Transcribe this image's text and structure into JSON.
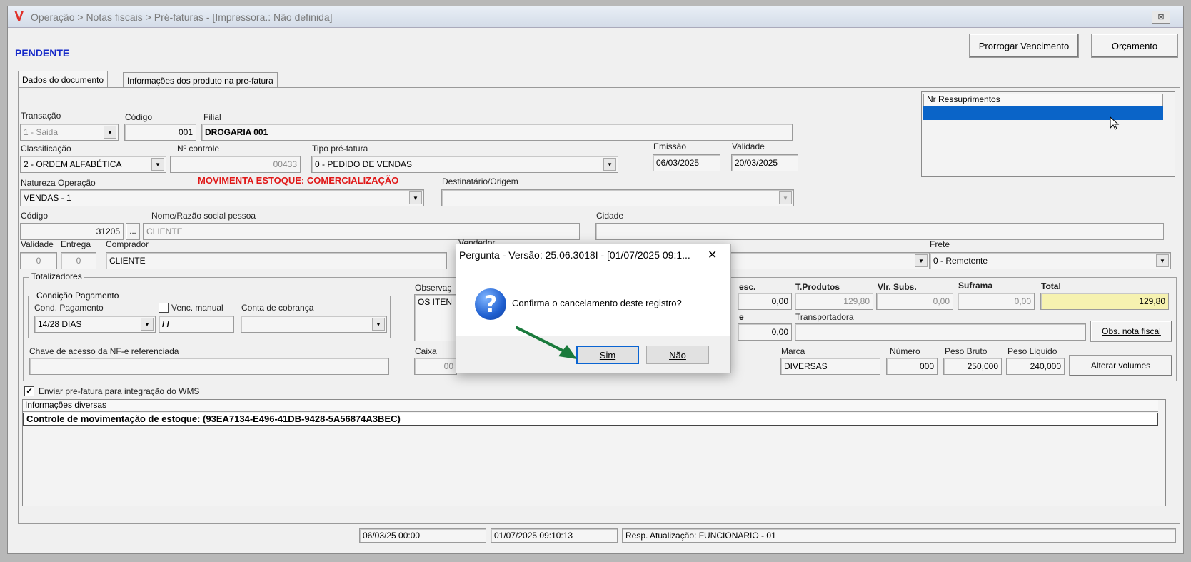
{
  "window": {
    "title": "Operação > Notas fiscais > Pré-faturas - [Impressora.: Não definida]",
    "close_glyph": "⊠",
    "logo_glyph": "V"
  },
  "status": "PENDENTE",
  "toolbar": {
    "prorrogar": "Prorrogar Vencimento",
    "orcamento": "Orçamento"
  },
  "tabs": [
    {
      "label": "Dados do documento"
    },
    {
      "label": "Informações dos produto na pre-fatura"
    }
  ],
  "form": {
    "transacao": {
      "label": "Transação",
      "value": "1 - Saida"
    },
    "codigo": {
      "label": "Código",
      "value": "001"
    },
    "filial": {
      "label": "Filial",
      "value": "DROGARIA 001"
    },
    "classificacao": {
      "label": "Classificação",
      "value": "2 - ORDEM ALFABÉTICA"
    },
    "nr_controle": {
      "label": "Nº controle",
      "value": "00433"
    },
    "tipo_prefatura": {
      "label": "Tipo pré-fatura",
      "value": "0  - PEDIDO DE VENDAS"
    },
    "emissao": {
      "label": "Emissão",
      "value": "06/03/2025"
    },
    "validade": {
      "label": "Validade",
      "value": "20/03/2025"
    },
    "natureza": {
      "label": "Natureza  Operação",
      "value": "VENDAS - 1"
    },
    "movimenta": "MOVIMENTA ESTOQUE: COMERCIALIZAÇÃO",
    "destinatario": {
      "label": "Destinatário/Origem",
      "value": ""
    },
    "cod_pessoa": {
      "label": "Código",
      "value": "31205"
    },
    "nome": {
      "label": "Nome/Razão social pessoa",
      "value": "CLIENTE"
    },
    "cidade": {
      "label": "Cidade",
      "value": ""
    },
    "validade2": {
      "label": "Validade",
      "value": "0"
    },
    "entrega": {
      "label": "Entrega",
      "value": "0"
    },
    "comprador": {
      "label": "Comprador",
      "value": "CLIENTE"
    },
    "vendedor": {
      "label": "Vendedor"
    },
    "frete": {
      "label": "Frete",
      "value": "0 - Remetente"
    },
    "ellipsis": "..."
  },
  "ressup": {
    "header": "Nr Ressuprimentos"
  },
  "totalizadores": {
    "label": "Totalizadores",
    "cond_group": "Condição Pagamento",
    "cond_label": "Cond. Pagamento",
    "cond_value": "14/28 DIAS",
    "venc_manual": "Venc. manual",
    "venc_value": "/ /",
    "conta": "Conta de cobrança",
    "observacao": "Observaç",
    "obs_value": "OS ITEN",
    "desc_label": "esc.",
    "desc_value": "0,00",
    "tprod_label": "T.Produtos",
    "tprod_value": "129,80",
    "vlsubs_label": "Vlr. Subs.",
    "vlsubs_value": "0,00",
    "suframa_label": "Suframa",
    "suframa_value": "0,00",
    "total_label": "Total",
    "total_value": "129,80",
    "e_label": "e",
    "e_value": "0,00",
    "transportadora": "Transportadora",
    "obs_nf": "Obs. nota fiscal",
    "chave": "Chave de acesso da NF-e referenciada",
    "caixa": "Caixa",
    "caixa_value": "00",
    "marca": "Marca",
    "marca_value": "DIVERSAS",
    "numero": "Número",
    "numero_value": "000",
    "peso_bruto": "Peso Bruto",
    "peso_bruto_value": "250,000",
    "peso_liq": "Peso Liquido",
    "peso_liq_value": "240,000",
    "alterar": "Alterar volumes"
  },
  "wms": "Enviar pre-fatura para integração do WMS",
  "info": {
    "header": "Informações diversas",
    "line": "Controle de movimentação de estoque: (93EA7134-E496-41DB-9428-5A56874A3BEC)"
  },
  "statusbar": [
    "06/03/25 00:00",
    "01/07/2025 09:10:13",
    "Resp. Atualização: FUNCIONARIO - 01"
  ],
  "dialog": {
    "title": "Pergunta - Versão: 25.06.3018I - [01/07/2025 09:1...",
    "message": "Confirma o cancelamento deste registro?",
    "icon": "?",
    "yes": "Sim",
    "no": "Não",
    "close": "✕"
  },
  "colors": {
    "accent": "#0a64d2",
    "status": "#1428c8",
    "warning": "#e01818",
    "arrow": "#1a7a3c"
  }
}
